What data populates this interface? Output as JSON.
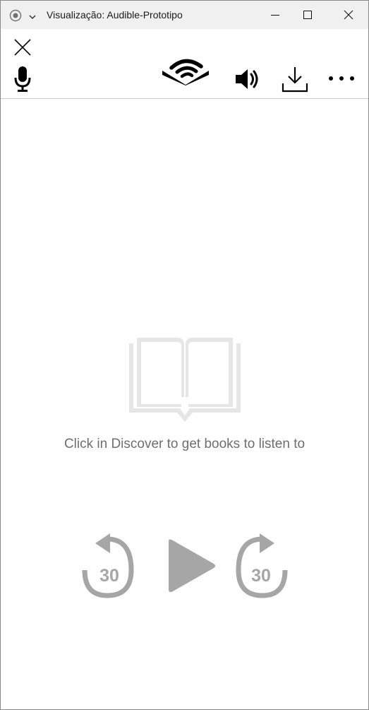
{
  "window": {
    "title": "Visualização: Audible-Prototipo"
  },
  "toolbar": {
    "icons": [
      "close-icon",
      "microphone-icon",
      "audible-logo",
      "speaker-icon",
      "download-icon",
      "more-icon"
    ]
  },
  "library": {
    "empty_message": "Click in Discover to get books to listen to"
  },
  "player": {
    "rewind_seconds": "30",
    "forward_seconds": "30"
  },
  "colors": {
    "icon_dark": "#000000",
    "icon_disabled": "#a6a6a6",
    "book_placeholder": "#e6e6e6",
    "text_muted": "#6e6e6e"
  }
}
